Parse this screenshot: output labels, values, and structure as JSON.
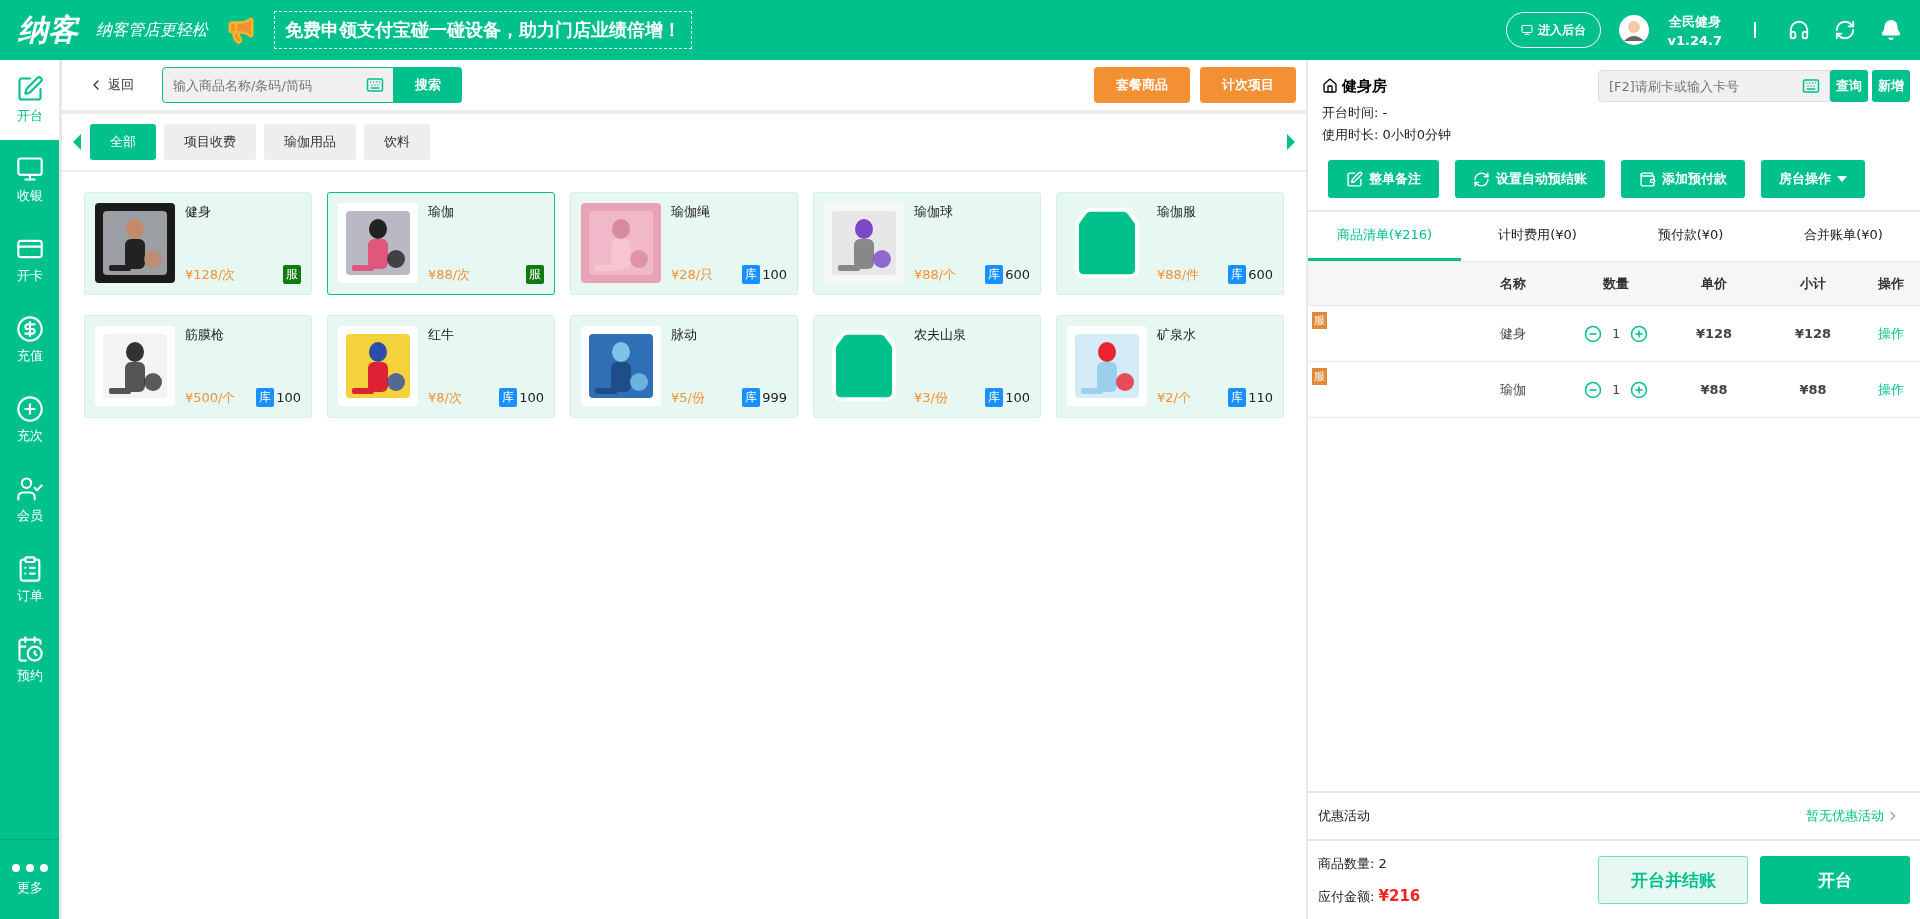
{
  "header": {
    "logo": "纳客",
    "slogan": "纳客管店更轻松",
    "banner": "免费申领支付宝碰一碰设备，助力门店业绩倍增！",
    "admin_button": "进入后台",
    "user": {
      "name": "全民健身",
      "version": "v1.24.7"
    }
  },
  "sidebar": {
    "items": [
      {
        "label": "开台",
        "selected": true
      },
      {
        "label": "收银",
        "selected": false
      },
      {
        "label": "开卡",
        "selected": false
      },
      {
        "label": "充值",
        "selected": false
      },
      {
        "label": "充次",
        "selected": false
      },
      {
        "label": "会员",
        "selected": false
      },
      {
        "label": "订单",
        "selected": false
      },
      {
        "label": "预约",
        "selected": false
      }
    ],
    "more": "更多"
  },
  "toolbar": {
    "back": "返回",
    "search_placeholder": "输入商品名称/条码/简码",
    "search_button": "搜索",
    "buttons": [
      "套餐商品",
      "计次项目"
    ]
  },
  "categories": [
    {
      "label": "全部",
      "selected": true
    },
    {
      "label": "项目收费",
      "selected": false
    },
    {
      "label": "瑜伽用品",
      "selected": false
    },
    {
      "label": "饮料",
      "selected": false
    }
  ],
  "products": [
    {
      "name": "健身",
      "price": "¥128/次",
      "badge": "服",
      "selected": false
    },
    {
      "name": "瑜伽",
      "price": "¥88/次",
      "badge": "服",
      "selected": true
    },
    {
      "name": "瑜伽绳",
      "price": "¥28/只",
      "badge": "库",
      "stock": "100",
      "selected": false
    },
    {
      "name": "瑜伽球",
      "price": "¥88/个",
      "badge": "库",
      "stock": "600",
      "selected": false
    },
    {
      "name": "瑜伽服",
      "price": "¥88/件",
      "kind": "bag",
      "badge": "库",
      "stock": "600",
      "selected": false
    },
    {
      "name": "筋膜枪",
      "price": "¥500/个",
      "badge": "库",
      "stock": "100",
      "selected": false
    },
    {
      "name": "红牛",
      "price": "¥8/次",
      "badge": "库",
      "stock": "100",
      "selected": false
    },
    {
      "name": "脉动",
      "price": "¥5/份",
      "badge": "库",
      "stock": "999",
      "selected": false
    },
    {
      "name": "农夫山泉",
      "price": "¥3/份",
      "kind": "bag",
      "badge": "库",
      "stock": "100",
      "selected": false
    },
    {
      "name": "矿泉水",
      "price": "¥2/个",
      "badge": "库",
      "stock": "110",
      "selected": false
    }
  ],
  "room": {
    "name": "健身房",
    "card_placeholder": "[F2]请刷卡或输入卡号",
    "query_button": "查询",
    "add_button": "新增",
    "open_time": "开台时间: -",
    "duration": "使用时长: 0小时0分钟"
  },
  "actions": [
    {
      "label": "整单备注",
      "kind": "button"
    },
    {
      "label": "设置自动预结账",
      "kind": "button"
    },
    {
      "label": "添加预付款",
      "kind": "button"
    },
    {
      "label": "房台操作",
      "kind": "dropdown"
    }
  ],
  "tabs": [
    {
      "label": "商品清单(¥216)",
      "selected": true
    },
    {
      "label": "计时费用(¥0)",
      "selected": false
    },
    {
      "label": "预付款(¥0)",
      "selected": false
    },
    {
      "label": "合并账单(¥0)",
      "selected": false
    }
  ],
  "cart": {
    "columns": [
      "名称",
      "数量",
      "单价",
      "小计",
      "操作"
    ],
    "rows": [
      {
        "tag": "服",
        "name": "健身",
        "qty": "1",
        "price": "¥128",
        "subtotal": "¥128",
        "action": "操作"
      },
      {
        "tag": "服",
        "name": "瑜伽",
        "qty": "1",
        "price": "¥88",
        "subtotal": "¥88",
        "action": "操作"
      }
    ]
  },
  "discount": {
    "label": "优惠活动",
    "value": "暂无优惠活动"
  },
  "summary": {
    "count": "商品数量: 2",
    "due_label": "应付金额:",
    "due": "¥216",
    "checkout_button": "开台并结账",
    "open_button": "开台"
  }
}
